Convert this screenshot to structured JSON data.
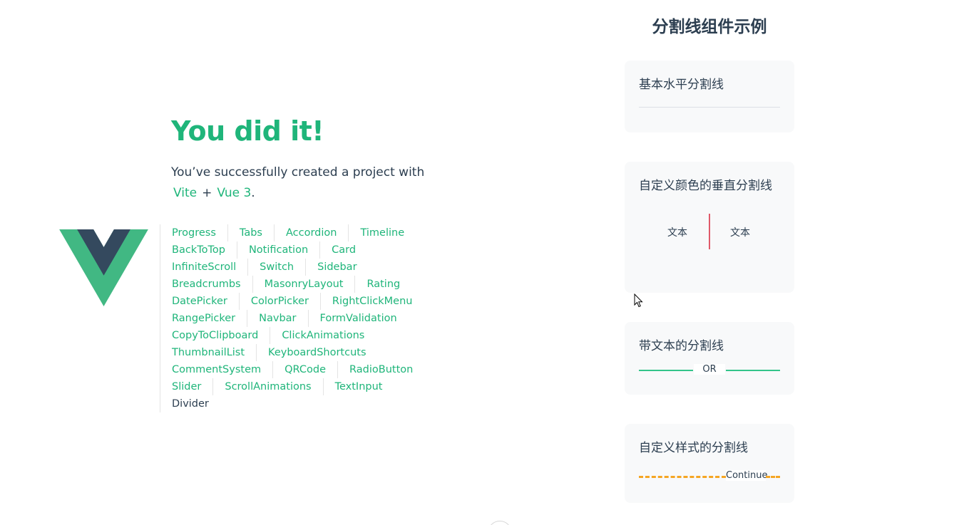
{
  "greeting": {
    "title": "You did it!",
    "subtitle": "You’ve successfully created a project with",
    "vite": "Vite",
    "plus": "+",
    "vue": "Vue 3",
    "period": "."
  },
  "nav": {
    "rows": [
      [
        "Progress",
        "Tabs",
        "Accordion",
        "Timeline"
      ],
      [
        "BackToTop",
        "Notification",
        "Card"
      ],
      [
        "InfiniteScroll",
        "Switch",
        "Sidebar"
      ],
      [
        "Breadcrumbs",
        "MasonryLayout",
        "Rating"
      ],
      [
        "DatePicker",
        "ColorPicker",
        "RightClickMenu"
      ],
      [
        "RangePicker",
        "Navbar",
        "FormValidation"
      ],
      [
        "CopyToClipboard",
        "ClickAnimations"
      ],
      [
        "ThumbnailList",
        "KeyboardShortcuts"
      ],
      [
        "CommentSystem",
        "QRCode",
        "RadioButton"
      ],
      [
        "Slider",
        "ScrollAnimations",
        "TextInput"
      ],
      [
        "Divider"
      ]
    ],
    "active": "Divider"
  },
  "demo": {
    "title": "分割线组件示例",
    "horizontal": {
      "label": "基本水平分割线"
    },
    "vertical": {
      "label": "自定义颜色的垂直分割线",
      "left_text": "文本",
      "right_text": "文本",
      "color": "#e05a6a"
    },
    "with_text": {
      "label": "带文本的分割线",
      "text": "OR",
      "color": "#33c48a"
    },
    "custom": {
      "label": "自定义样式的分割线",
      "text": "Continue",
      "color": "#f5a623"
    }
  },
  "colors": {
    "accent": "#1fb57a",
    "text": "#2c3e50",
    "card_bg": "#f8f9fa"
  }
}
